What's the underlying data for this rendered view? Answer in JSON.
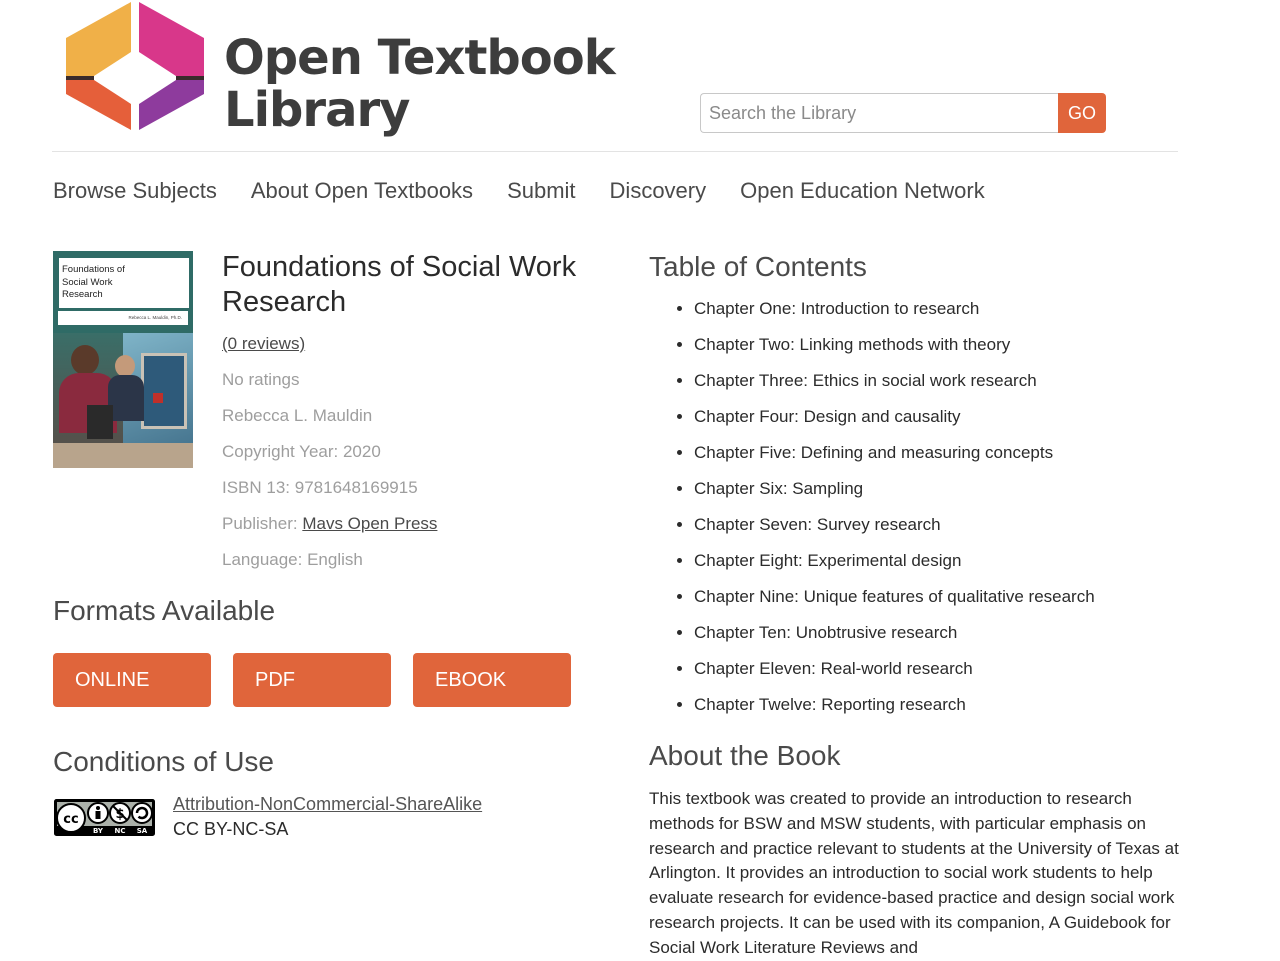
{
  "header": {
    "logo_line1": "Open Textbook",
    "logo_line2": "Library",
    "search": {
      "placeholder": "Search the Library",
      "value": "",
      "go_label": "GO"
    }
  },
  "colors": {
    "accent": "#e0653b",
    "logo_yellow": "#f0b048",
    "logo_pink": "#d8378a",
    "logo_purple": "#8e3b9d",
    "logo_orange": "#e55f3a",
    "cover_green": "#2f6b66"
  },
  "nav": {
    "items": [
      {
        "label": "Browse Subjects"
      },
      {
        "label": "About Open Textbooks"
      },
      {
        "label": "Submit"
      },
      {
        "label": "Discovery"
      },
      {
        "label": "Open Education Network"
      }
    ]
  },
  "book": {
    "title": "Foundations of Social Work Research",
    "cover": {
      "title": "Foundations of Social Work Research",
      "author": "Rebecca L. Mauldin, Ph.D."
    },
    "reviews": "(0 reviews)",
    "ratings": "No ratings",
    "author": "Rebecca L. Mauldin",
    "copyright": "Copyright Year: 2020",
    "isbn": "ISBN 13: 9781648169915",
    "publisher_label": "Publisher: ",
    "publisher": "Mavs Open Press",
    "language": "Language: English"
  },
  "formats": {
    "heading": "Formats Available",
    "buttons": [
      "ONLINE",
      "PDF",
      "EBOOK"
    ]
  },
  "conditions": {
    "heading": "Conditions of Use",
    "license_name": "Attribution-NonCommercial-ShareAlike",
    "license_short": "CC BY-NC-SA",
    "badge_labels": [
      "BY",
      "NC",
      "SA"
    ]
  },
  "toc": {
    "heading": "Table of Contents",
    "items": [
      "Chapter One: Introduction to research",
      "Chapter Two: Linking methods with theory",
      "Chapter Three: Ethics in social work research",
      "Chapter Four: Design and causality",
      "Chapter Five: Defining and measuring concepts",
      "Chapter Six: Sampling",
      "Chapter Seven: Survey research",
      "Chapter Eight: Experimental design",
      "Chapter Nine: Unique features of qualitative research",
      "Chapter Ten: Unobtrusive research",
      "Chapter Eleven: Real-world research",
      "Chapter Twelve: Reporting research"
    ]
  },
  "about": {
    "heading": "About the Book",
    "text": "This textbook was created to provide an introduction to research methods for BSW and MSW students, with particular emphasis on research and practice relevant to students at the University of Texas at Arlington. It provides an introduction to social work students to help evaluate research for evidence-based practice and design social work research projects. It can be used with its companion, A Guidebook for Social Work Literature Reviews and"
  }
}
